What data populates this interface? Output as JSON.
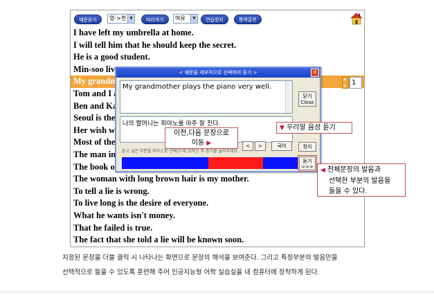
{
  "toolbar": {
    "btn_listen_sentence": "예문듣기",
    "select_lang": "영->한",
    "btn_repeat": "따라하기",
    "select_speed": "여유",
    "btn_stop_practice": "연습정지",
    "btn_shadowing": "통역훈련"
  },
  "sentences": [
    "I have left my umbrella at home.",
    "I will tell him that he should keep the secret.",
    "He is a good student.",
    "Min-soo live",
    "My grandmo",
    "Tom and I a",
    "Ben and Ka",
    "Seoul is the",
    "Her wish wa",
    "Most of the",
    "The man in",
    "The book o",
    "The woman with long brown hair is my mother.",
    "To tell a lie is wrong.",
    "To live long is the desire of everyone.",
    "What he wants isn't money.",
    "That he failed is true.",
    "The fact that she told a lie will be known soon."
  ],
  "selected_index": 4,
  "sentence_number": "1",
  "dialog": {
    "title": "<   예문을 세부적으로 선택하여 듣기   >",
    "english": "My grandmother plays the piano very well.",
    "korean": "나의 할머니는 피아노를 아주 잘 친다.",
    "close_label_1": "닫기",
    "close_label_2": "Close",
    "prev": "<",
    "next": ">",
    "korean_btn": "국어",
    "stop_btn": "정지",
    "listen_label_1": "듣기",
    "listen_label_2": ">>>",
    "hint": "듣고 싶은 부분을 마우스로 선택(드래그)하신 후 듣기를 눌러주세요.",
    "selection": {
      "start": 0.49,
      "end": 0.8
    }
  },
  "callouts": {
    "prev_next_1": "이전,다음 문장으로",
    "prev_next_2": "이동",
    "our_voice": "우리말 음성 듣기",
    "full_1": "전체문장의 발음과",
    "full_2": "선택한 부분의 발음을",
    "full_3": "들을 수 있다."
  },
  "caption": {
    "line1": "지정된 문장을 더블 클릭 시 나타나는 화면으로 문장의 해석을 보여준다. 그리고 특정부분의 발음만을",
    "line2": "선택적으로 들을 수 있도록 훈련해 주어 인공지능형 어학 실습실을 내 컴퓨터에 장착하게 된다."
  },
  "colors": {
    "highlight": "#f2a53a",
    "bar_blue": "#0a14ff",
    "bar_red": "#ff1a1a",
    "callout_border": "#c0504d"
  }
}
